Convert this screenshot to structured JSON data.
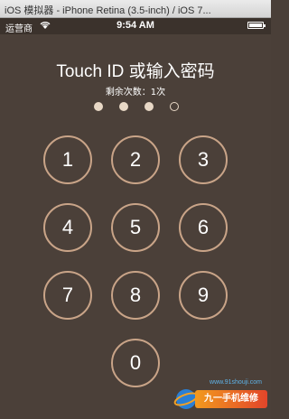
{
  "window": {
    "title": "iOS 模拟器 - iPhone Retina (3.5-inch) / iOS 7..."
  },
  "statusbar": {
    "carrier": "运营商",
    "time": "9:54 AM"
  },
  "lockscreen": {
    "heading": "Touch ID 或输入密码",
    "attempts": "剩余次数：1次",
    "passcode": {
      "length": 4,
      "entered": 3
    },
    "keys": [
      "1",
      "2",
      "3",
      "4",
      "5",
      "6",
      "7",
      "8",
      "9",
      "0"
    ]
  },
  "watermark": {
    "url": "www.91shouji.com",
    "label": "九一手机维修"
  },
  "colors": {
    "background": "#4b4039",
    "ring": "#c9a488",
    "text": "#ffffff"
  }
}
